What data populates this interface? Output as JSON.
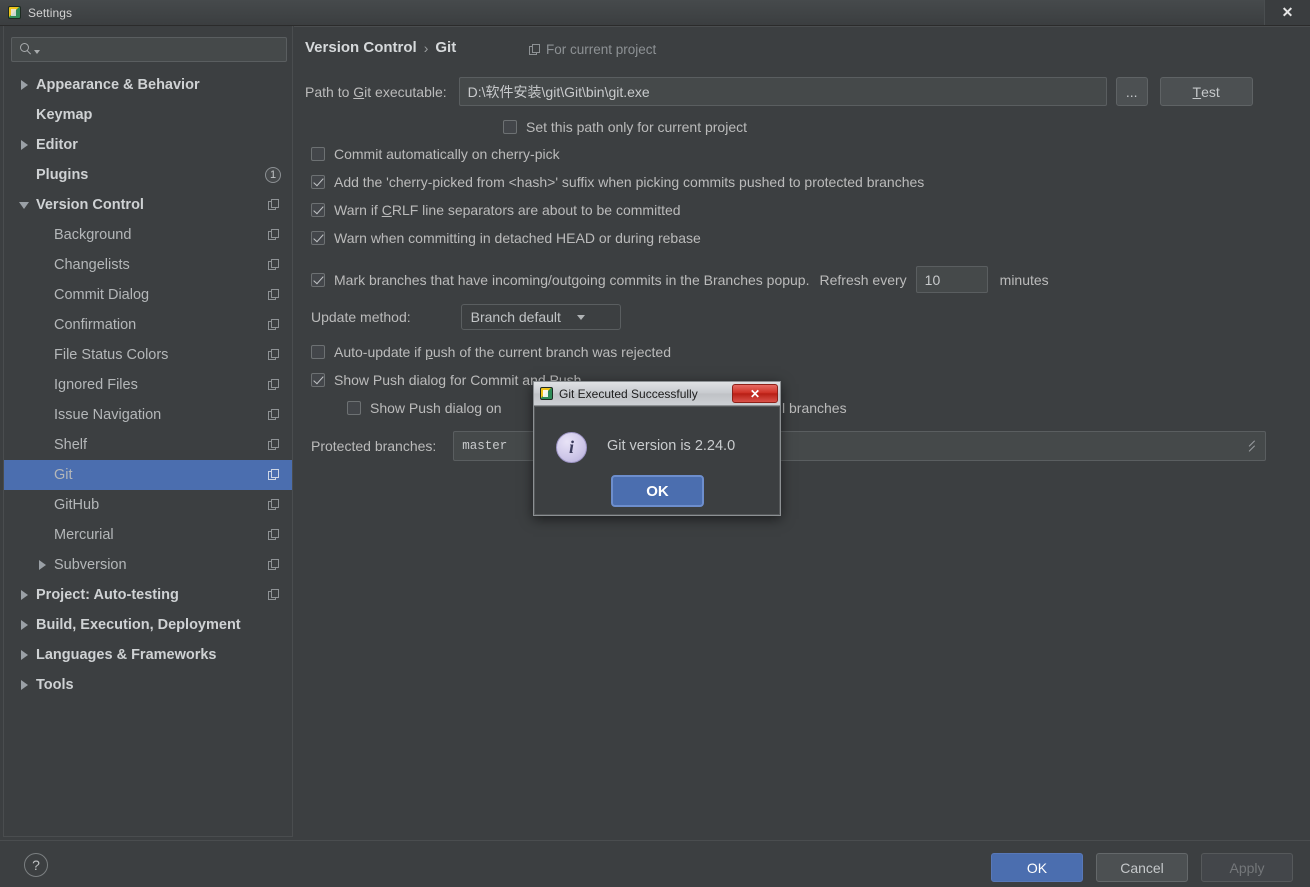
{
  "window": {
    "title": "Settings",
    "close_label": "✕",
    "app_icon": "intellij-icon"
  },
  "sidebar": {
    "search": {
      "value": "",
      "placeholder": ""
    },
    "items": [
      {
        "label": "Appearance & Behavior",
        "level": 0,
        "twisty": "right",
        "bold": true,
        "scope_icon": false,
        "badge": null,
        "selected": false
      },
      {
        "label": "Keymap",
        "level": 0,
        "twisty": "none",
        "bold": true,
        "scope_icon": false,
        "badge": null,
        "selected": false
      },
      {
        "label": "Editor",
        "level": 0,
        "twisty": "right",
        "bold": true,
        "scope_icon": false,
        "badge": null,
        "selected": false
      },
      {
        "label": "Plugins",
        "level": 0,
        "twisty": "none",
        "bold": true,
        "scope_icon": false,
        "badge": "1",
        "selected": false
      },
      {
        "label": "Version Control",
        "level": 0,
        "twisty": "down",
        "bold": true,
        "scope_icon": true,
        "badge": null,
        "selected": false
      },
      {
        "label": "Background",
        "level": 1,
        "twisty": "none",
        "bold": false,
        "scope_icon": true,
        "badge": null,
        "selected": false
      },
      {
        "label": "Changelists",
        "level": 1,
        "twisty": "none",
        "bold": false,
        "scope_icon": true,
        "badge": null,
        "selected": false
      },
      {
        "label": "Commit Dialog",
        "level": 1,
        "twisty": "none",
        "bold": false,
        "scope_icon": true,
        "badge": null,
        "selected": false
      },
      {
        "label": "Confirmation",
        "level": 1,
        "twisty": "none",
        "bold": false,
        "scope_icon": true,
        "badge": null,
        "selected": false
      },
      {
        "label": "File Status Colors",
        "level": 1,
        "twisty": "none",
        "bold": false,
        "scope_icon": true,
        "badge": null,
        "selected": false
      },
      {
        "label": "Ignored Files",
        "level": 1,
        "twisty": "none",
        "bold": false,
        "scope_icon": true,
        "badge": null,
        "selected": false
      },
      {
        "label": "Issue Navigation",
        "level": 1,
        "twisty": "none",
        "bold": false,
        "scope_icon": true,
        "badge": null,
        "selected": false
      },
      {
        "label": "Shelf",
        "level": 1,
        "twisty": "none",
        "bold": false,
        "scope_icon": true,
        "badge": null,
        "selected": false
      },
      {
        "label": "Git",
        "level": 1,
        "twisty": "none",
        "bold": false,
        "scope_icon": true,
        "badge": null,
        "selected": true
      },
      {
        "label": "GitHub",
        "level": 1,
        "twisty": "none",
        "bold": false,
        "scope_icon": true,
        "badge": null,
        "selected": false
      },
      {
        "label": "Mercurial",
        "level": 1,
        "twisty": "none",
        "bold": false,
        "scope_icon": true,
        "badge": null,
        "selected": false
      },
      {
        "label": "Subversion",
        "level": 1,
        "twisty": "right",
        "bold": false,
        "scope_icon": true,
        "badge": null,
        "selected": false
      },
      {
        "label": "Project: Auto-testing",
        "level": 0,
        "twisty": "right",
        "bold": true,
        "scope_icon": true,
        "badge": null,
        "selected": false
      },
      {
        "label": "Build, Execution, Deployment",
        "level": 0,
        "twisty": "right",
        "bold": true,
        "scope_icon": false,
        "badge": null,
        "selected": false
      },
      {
        "label": "Languages & Frameworks",
        "level": 0,
        "twisty": "right",
        "bold": true,
        "scope_icon": false,
        "badge": null,
        "selected": false
      },
      {
        "label": "Tools",
        "level": 0,
        "twisty": "right",
        "bold": true,
        "scope_icon": false,
        "badge": null,
        "selected": false
      }
    ]
  },
  "content": {
    "breadcrumb": {
      "section": "Version Control",
      "separator": "›",
      "current": "Git"
    },
    "scope_note": "For current project",
    "path_row": {
      "label_pre": "Path to ",
      "label_mnemonic": "G",
      "label_post": "it executable:",
      "value": "D:\\软件安装\\git\\Git\\bin\\git.exe",
      "browse_label": "...",
      "test_label_mnemonic": "T",
      "test_label_rest": "est"
    },
    "checkboxes": [
      {
        "checked": false,
        "text": "Set this path only for current project"
      },
      {
        "checked": false,
        "text": "Commit automatically on cherry-pick"
      },
      {
        "checked": true,
        "text": "Add the 'cherry-picked from <hash>' suffix when picking commits pushed to protected branches"
      },
      {
        "checked": true,
        "text_pre": "Warn if ",
        "mnemonic": "C",
        "text_post": "RLF line separators are about to be committed"
      },
      {
        "checked": true,
        "text": "Warn when committing in detached HEAD or during rebase"
      }
    ],
    "mark_branches": {
      "checked": true,
      "text": "Mark branches that have incoming/outgoing commits in the Branches popup.",
      "refresh_label": "Refresh every",
      "refresh_value": "10",
      "minutes_label": "minutes"
    },
    "update_method": {
      "label": "Update method:",
      "value": "Branch default"
    },
    "auto_update": {
      "checked": false,
      "text_pre": "Auto-update if ",
      "mnemonic": "p",
      "text_post": "ush of the current branch was rejected"
    },
    "show_push_dialog": {
      "checked": true,
      "text": "Show Push dialog for Commit and Push"
    },
    "show_push_protected": {
      "checked": false,
      "text_visible_left": "Show Push dialog on",
      "text_visible_right": "l branches"
    },
    "protected_branches": {
      "label": "Protected branches:",
      "value": "master"
    }
  },
  "bottom_bar": {
    "help_label": "?",
    "ok_label": "OK",
    "cancel_label": "Cancel",
    "apply_label": "Apply"
  },
  "modal": {
    "title": "Git Executed Successfully",
    "close_label": "✕",
    "message": "Git version is 2.24.0",
    "ok_label": "OK",
    "icon": "info-icon"
  },
  "colors": {
    "window_bg": "#3c3f41",
    "selection_blue": "#4b6eaf",
    "text_primary": "#bbbbbb",
    "input_bg": "#45494a",
    "modal_close_red": "#cf3328"
  }
}
